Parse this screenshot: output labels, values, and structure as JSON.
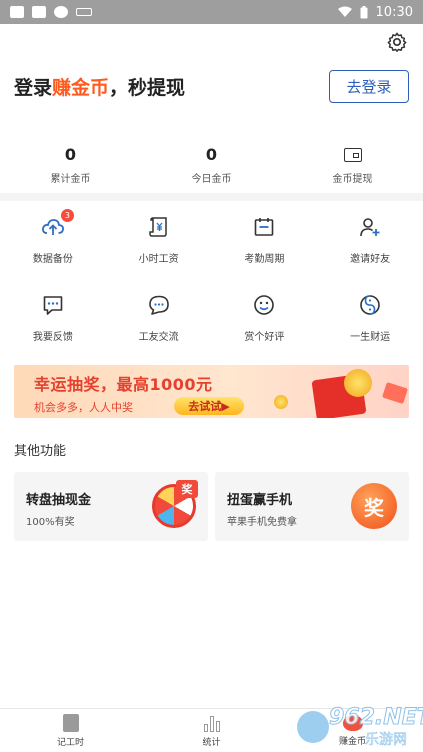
{
  "status_bar": {
    "time": "10:30",
    "icons": [
      "photo-icon",
      "bag-icon",
      "sync-icon",
      "notification-icon",
      "wifi-icon",
      "battery-icon"
    ]
  },
  "header": {
    "settings_icon": "gear-icon",
    "login_title_prefix": "登录",
    "login_title_highlight": "赚金币",
    "login_title_suffix": "，秒提现",
    "login_button": "去登录"
  },
  "stats": [
    {
      "value": "0",
      "label": "累计金币"
    },
    {
      "value": "0",
      "label": "今日金币"
    },
    {
      "icon": "wallet-icon",
      "label": "金币提现"
    }
  ],
  "features": [
    {
      "label": "数据备份",
      "icon": "cloud-upload-icon",
      "badge": "3"
    },
    {
      "label": "小时工资",
      "icon": "scroll-yen-icon"
    },
    {
      "label": "考勤周期",
      "icon": "calendar-icon"
    },
    {
      "label": "邀请好友",
      "icon": "add-user-icon"
    },
    {
      "label": "我要反馈",
      "icon": "feedback-icon"
    },
    {
      "label": "工友交流",
      "icon": "chat-icon"
    },
    {
      "label": "赏个好评",
      "icon": "smile-icon"
    },
    {
      "label": "一生财运",
      "icon": "yin-yang-icon"
    }
  ],
  "banner": {
    "title": "幸运抽奖，最高1000元",
    "subtitle": "机会多多，人人中奖",
    "button": "去试试▶"
  },
  "other_section": {
    "title": "其他功能",
    "cards": [
      {
        "title": "转盘抽现金",
        "subtitle": "100%有奖",
        "tag": "奖"
      },
      {
        "title": "扭蛋赢手机",
        "subtitle": "苹果手机免费拿",
        "tag": "奖"
      }
    ]
  },
  "tabbar": {
    "tabs": [
      {
        "label": "记工时",
        "icon": "edit-icon"
      },
      {
        "label": "统计",
        "icon": "bar-chart-icon"
      },
      {
        "label": "赚金币",
        "icon": "piggy-bank-icon"
      }
    ]
  },
  "watermark": {
    "top": "962.NET",
    "bottom": "乐游网"
  },
  "colors": {
    "accent": "#ff5a1f",
    "primary_blue": "#2e5fb8",
    "icon_blue": "#2e6fc4",
    "badge_red": "#f24e3b"
  }
}
